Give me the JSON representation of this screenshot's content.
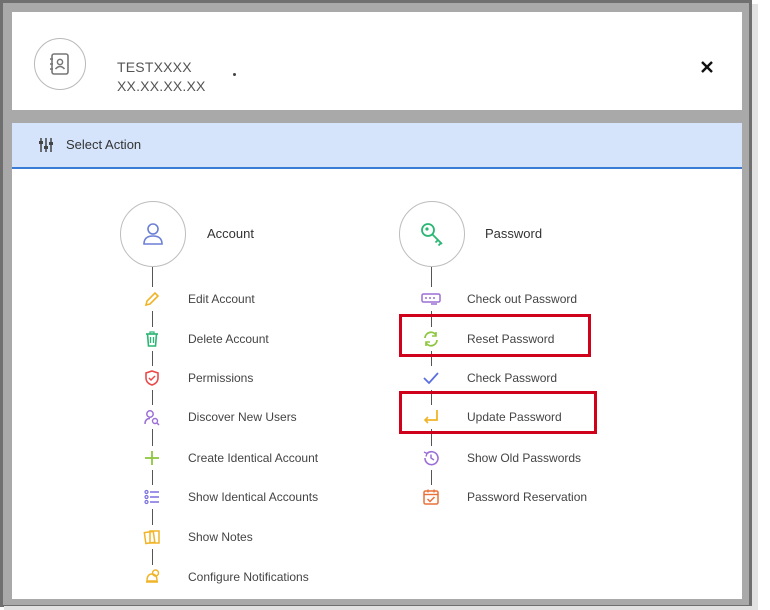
{
  "header": {
    "account_name": "TESTXXXX",
    "account_address": "XX.XX.XX.XX",
    "avatar_icon": "address-book-icon",
    "close_symbol": "✕"
  },
  "action_bar": {
    "label": "Select Action",
    "icon": "sliders-icon",
    "accent": "#3a7bd5",
    "background": "#d6e4fb"
  },
  "account_column": {
    "title": "Account",
    "icon": "user-icon",
    "items": [
      {
        "label": "Edit Account",
        "icon": "pencil-icon",
        "color": "#f0b429"
      },
      {
        "label": "Delete Account",
        "icon": "trash-icon",
        "color": "#2bb673"
      },
      {
        "label": "Permissions",
        "icon": "shield-icon",
        "color": "#e94b4b"
      },
      {
        "label": "Discover New Users",
        "icon": "user-search-icon",
        "color": "#9b6fd6"
      },
      {
        "label": "Create Identical Account",
        "icon": "plus-icon",
        "color": "#8dc63f"
      },
      {
        "label": "Show Identical Accounts",
        "icon": "list-icon",
        "color": "#7a6fe0"
      },
      {
        "label": "Show Notes",
        "icon": "notes-icon",
        "color": "#f0b429"
      },
      {
        "label": "Configure Notifications",
        "icon": "bell-gear-icon",
        "color": "#f0b429"
      }
    ]
  },
  "password_column": {
    "title": "Password",
    "icon": "key-icon",
    "items": [
      {
        "label": "Check out Password",
        "icon": "password-field-icon",
        "color": "#9b6fd6"
      },
      {
        "label": "Reset Password",
        "icon": "refresh-icon",
        "color": "#8dc63f"
      },
      {
        "label": "Check Password",
        "icon": "checkmark-icon",
        "color": "#5a6fe0"
      },
      {
        "label": "Update Password",
        "icon": "enter-arrow-icon",
        "color": "#f0b429"
      },
      {
        "label": "Show Old Passwords",
        "icon": "history-icon",
        "color": "#9b6fd6"
      },
      {
        "label": "Password Reservation",
        "icon": "calendar-check-icon",
        "color": "#e9703a"
      }
    ]
  },
  "highlight_color": "#d0021b"
}
